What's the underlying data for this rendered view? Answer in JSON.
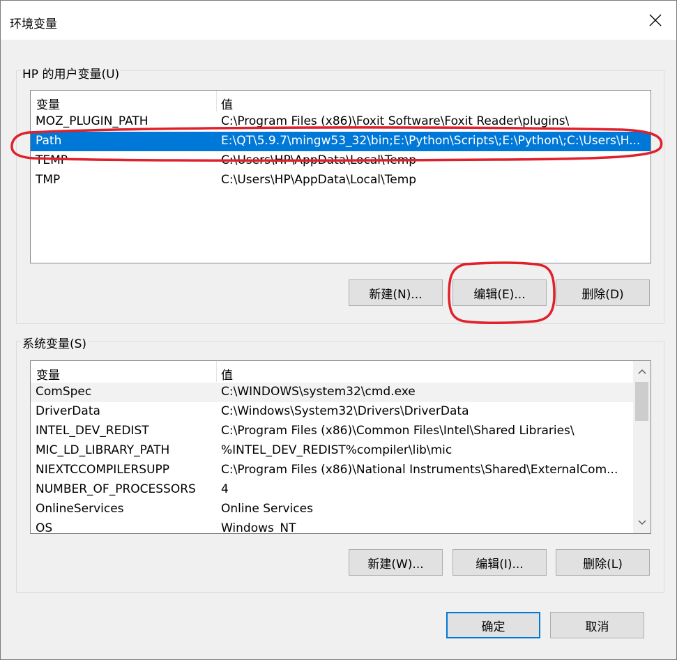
{
  "window": {
    "title": "环境变量",
    "close_icon": "close-icon"
  },
  "user_vars": {
    "group_title": "HP 的用户变量(U)",
    "header": {
      "name": "变量",
      "value": "值"
    },
    "rows": [
      {
        "name": "MOZ_PLUGIN_PATH",
        "value": "C:\\Program Files (x86)\\Foxit Software\\Foxit Reader\\plugins\\",
        "selected": false
      },
      {
        "name": "Path",
        "value": "E:\\QT\\5.9.7\\mingw53_32\\bin;E:\\Python\\Scripts\\;E:\\Python\\;C:\\Users\\H...",
        "selected": true
      },
      {
        "name": "TEMP",
        "value": "C:\\Users\\HP\\AppData\\Local\\Temp",
        "selected": false
      },
      {
        "name": "TMP",
        "value": "C:\\Users\\HP\\AppData\\Local\\Temp",
        "selected": false
      }
    ],
    "buttons": {
      "new": "新建(N)...",
      "edit": "编辑(E)...",
      "delete": "删除(D)"
    }
  },
  "system_vars": {
    "group_title": "系统变量(S)",
    "header": {
      "name": "变量",
      "value": "值"
    },
    "rows": [
      {
        "name": "ComSpec",
        "value": "C:\\WINDOWS\\system32\\cmd.exe",
        "hover": true
      },
      {
        "name": "DriverData",
        "value": "C:\\Windows\\System32\\Drivers\\DriverData",
        "hover": false
      },
      {
        "name": "INTEL_DEV_REDIST",
        "value": "C:\\Program Files (x86)\\Common Files\\Intel\\Shared Libraries\\",
        "hover": false
      },
      {
        "name": "MIC_LD_LIBRARY_PATH",
        "value": "%INTEL_DEV_REDIST%compiler\\lib\\mic",
        "hover": false
      },
      {
        "name": "NIEXTCCOMPILERSUPP",
        "value": "C:\\Program Files (x86)\\National Instruments\\Shared\\ExternalCom...",
        "hover": false
      },
      {
        "name": "NUMBER_OF_PROCESSORS",
        "value": "4",
        "hover": false
      },
      {
        "name": "OnlineServices",
        "value": "Online Services",
        "hover": false
      },
      {
        "name": "OS",
        "value": "Windows_NT",
        "hover": false
      }
    ],
    "buttons": {
      "new": "新建(W)...",
      "edit": "编辑(I)...",
      "delete": "删除(L)"
    }
  },
  "footer": {
    "ok": "确定",
    "cancel": "取消"
  },
  "colors": {
    "selection": "#0078d7",
    "annotation": "#e0202a",
    "button_face": "#e1e1e1",
    "dialog_bg": "#f0f0f0"
  }
}
